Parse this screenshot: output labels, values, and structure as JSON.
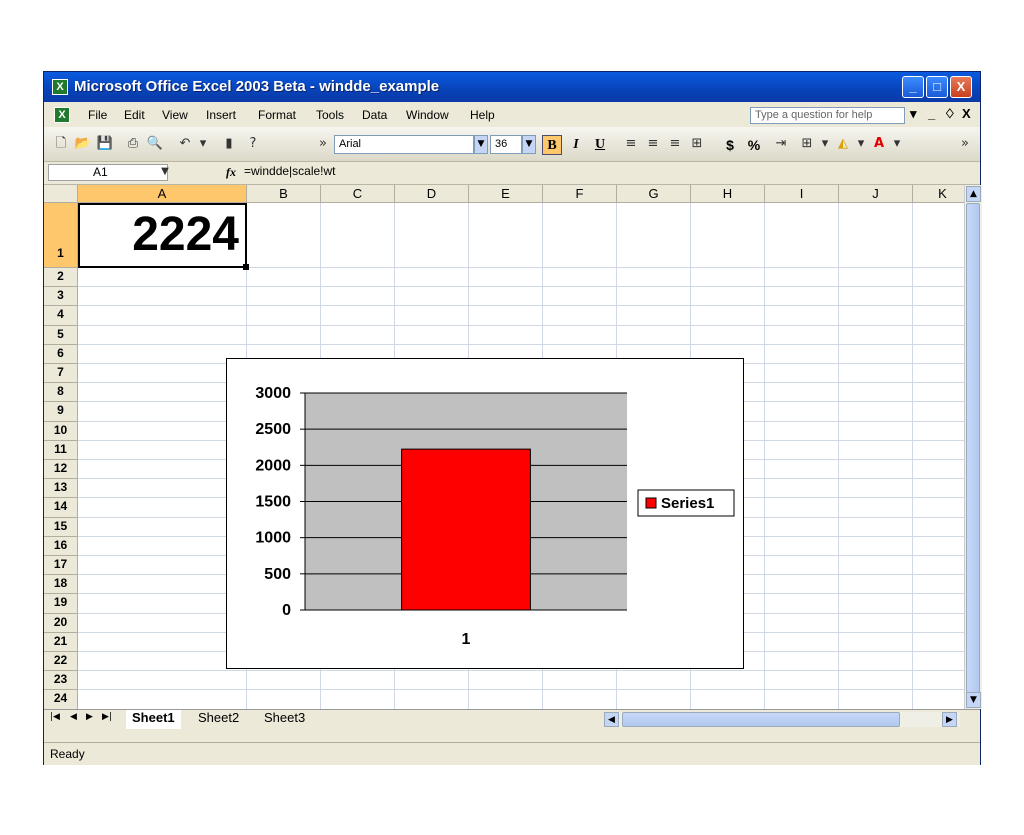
{
  "window": {
    "title": "Microsoft Office Excel 2003 Beta - windde_example",
    "app_icon": "excel-icon",
    "minimize_label": "_",
    "maximize_label": "□",
    "close_label": "X"
  },
  "menu": {
    "items": [
      "File",
      "Edit",
      "View",
      "Insert",
      "Format",
      "Tools",
      "Data",
      "Window",
      "Help"
    ],
    "help_placeholder": "Type a question for help",
    "doc_minimize": "_",
    "doc_restore": "♢",
    "doc_close": "X"
  },
  "toolbar": {
    "font_name": "Arial",
    "font_size": "36",
    "bold_label": "B",
    "italic_label": "I",
    "underline_label": "U",
    "currency_label": "$",
    "percent_label": "%"
  },
  "formula_bar": {
    "name_box": "A1",
    "fx_label": "fx",
    "formula": "=windde|scale!wt"
  },
  "sheet": {
    "columns": [
      "A",
      "B",
      "C",
      "D",
      "E",
      "F",
      "G",
      "H",
      "I",
      "J",
      "K"
    ],
    "selected_column": "A",
    "rows": [
      "1",
      "2",
      "3",
      "4",
      "5",
      "6",
      "7",
      "8",
      "9",
      "10",
      "11",
      "12",
      "13",
      "14",
      "15",
      "16",
      "17",
      "18",
      "19",
      "20",
      "21",
      "22",
      "23",
      "24"
    ],
    "active_cell_value": "2224"
  },
  "tabs": {
    "items": [
      "Sheet1",
      "Sheet2",
      "Sheet3"
    ],
    "active": "Sheet1"
  },
  "status": {
    "text": "Ready"
  },
  "chart_data": {
    "type": "bar",
    "categories": [
      "1"
    ],
    "series": [
      {
        "name": "Series1",
        "values": [
          2224
        ],
        "color": "#ff0000"
      }
    ],
    "ylim": [
      0,
      3000
    ],
    "yticks": [
      0,
      500,
      1000,
      1500,
      2000,
      2500,
      3000
    ],
    "grid": true,
    "plot_background": "#c0c0c0",
    "legend": "right",
    "title": "",
    "xlabel": "",
    "ylabel": ""
  }
}
